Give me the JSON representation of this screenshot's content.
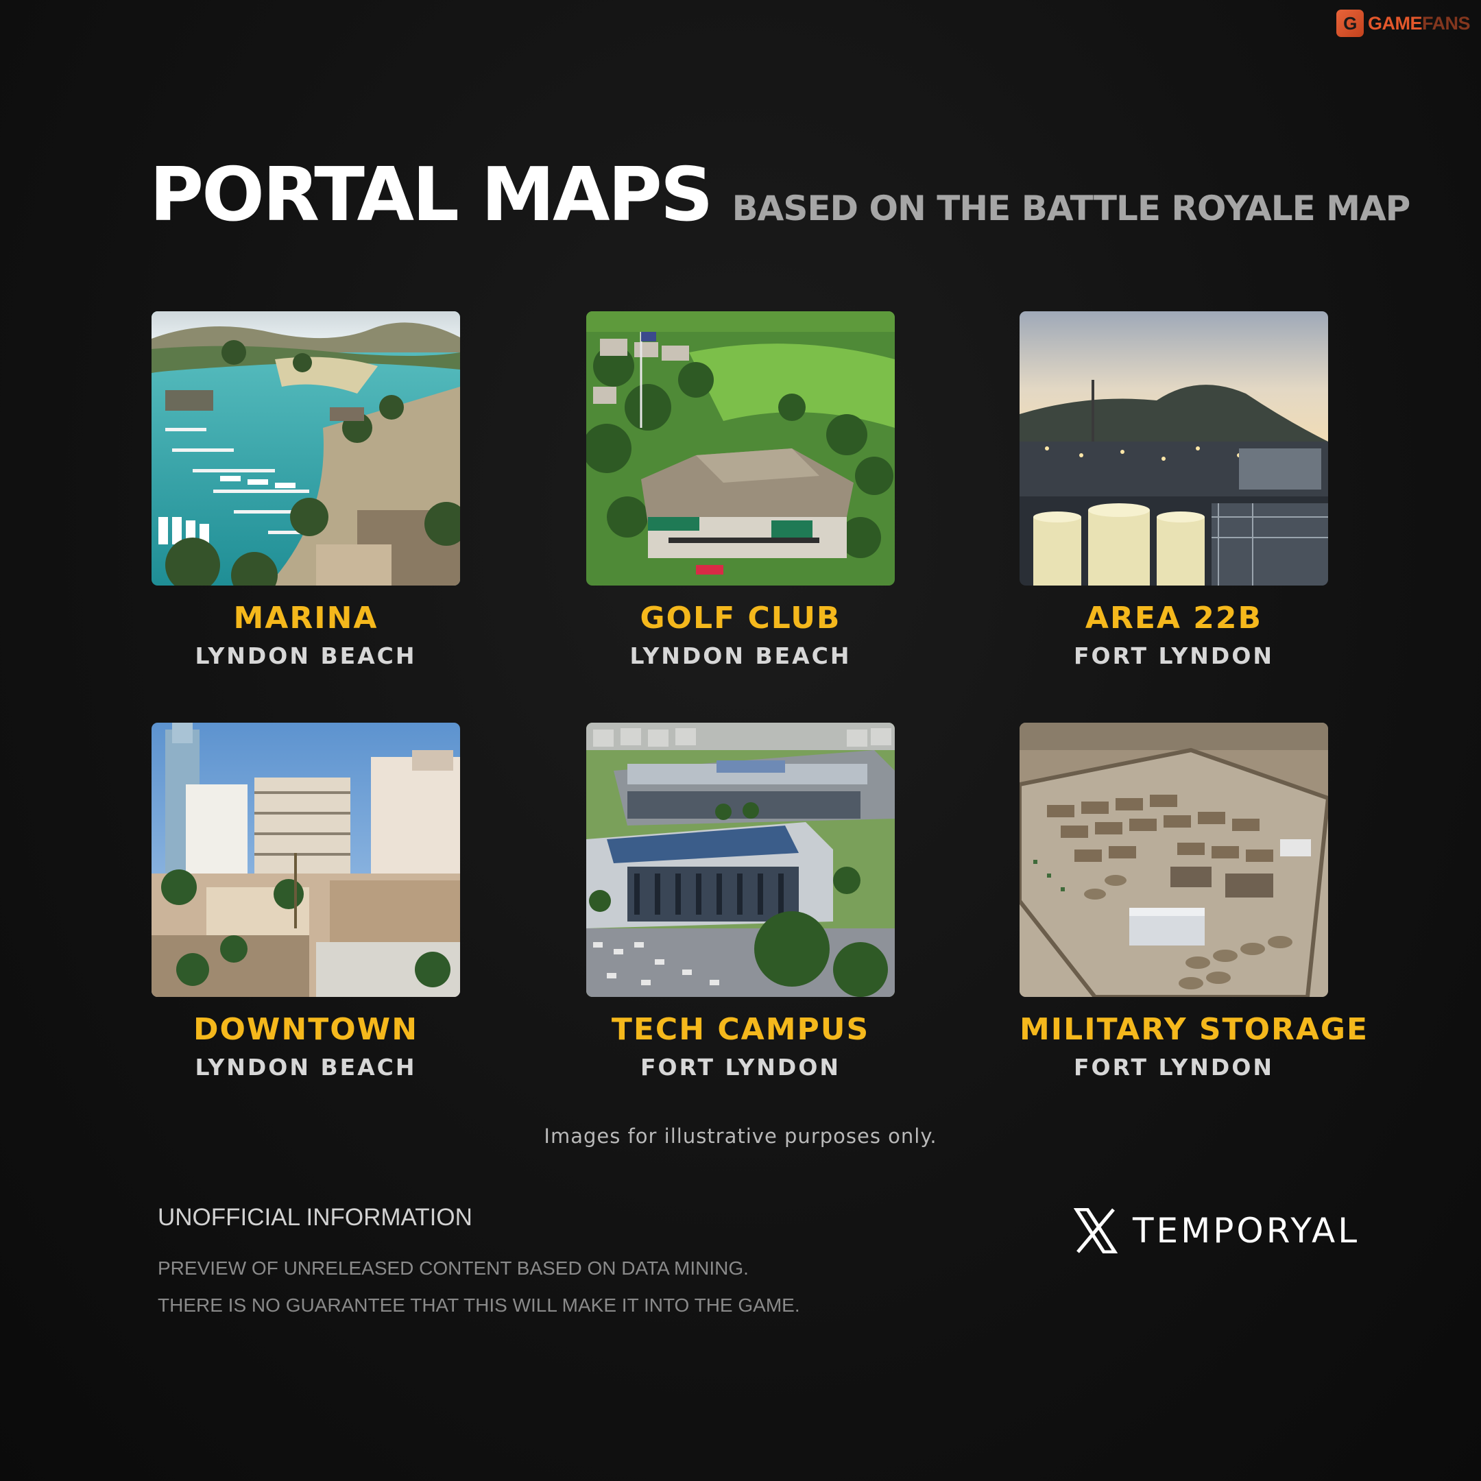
{
  "brand": {
    "part1": "GAME",
    "part2": "FANS",
    "icon": "g-logo-icon",
    "color": "#e3572b"
  },
  "header": {
    "title": "PORTAL MAPS",
    "subtitle": "BASED ON THE BATTLE ROYALE MAP"
  },
  "maps": [
    {
      "name": "MARINA",
      "region": "LYNDON BEACH",
      "image": "marina-aerial-photo"
    },
    {
      "name": "GOLF CLUB",
      "region": "LYNDON BEACH",
      "image": "golf-club-aerial-photo"
    },
    {
      "name": "AREA 22B",
      "region": "FORT LYNDON",
      "image": "refinery-dusk-photo"
    },
    {
      "name": "DOWNTOWN",
      "region": "LYNDON BEACH",
      "image": "downtown-skyline-photo"
    },
    {
      "name": "TECH CAMPUS",
      "region": "FORT LYNDON",
      "image": "tech-campus-aerial-photo"
    },
    {
      "name": "MILITARY STORAGE",
      "region": "FORT LYNDON",
      "image": "military-base-aerial-photo"
    }
  ],
  "disclaimer": "Images for illustrative purposes only.",
  "notice": {
    "heading": "UNOFFICIAL INFORMATION",
    "line1": "PREVIEW OF UNRELEASED CONTENT BASED ON DATA MINING.",
    "line2": "THERE IS NO GUARANTEE THAT THIS WILL MAKE IT INTO THE GAME."
  },
  "credit": {
    "platform_icon": "x-logo-icon",
    "handle": "TEMPORYAL"
  },
  "colors": {
    "accent": "#f5b81c",
    "background": "#121212"
  }
}
